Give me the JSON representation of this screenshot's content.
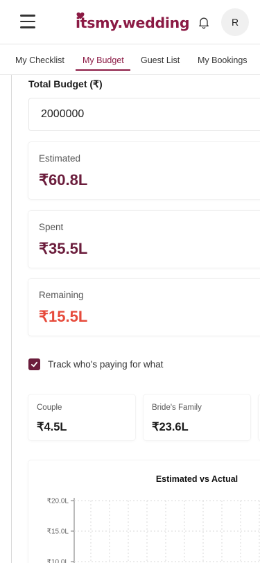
{
  "header": {
    "logo_text": "itsmy.wedding",
    "avatar_initial": "R",
    "brand_color": "#8b1a44"
  },
  "tabs": [
    {
      "label": "My Checklist",
      "active": false
    },
    {
      "label": "My Budget",
      "active": true
    },
    {
      "label": "Guest List",
      "active": false
    },
    {
      "label": "My Bookings",
      "active": false
    }
  ],
  "budget": {
    "total_label": "Total Budget (₹)",
    "total_value": "2000000"
  },
  "stats": [
    {
      "label": "Estimated",
      "value": "₹60.8L",
      "color": "#6b1d3c"
    },
    {
      "label": "Spent",
      "value": "₹35.5L",
      "color": "#6b1d3c"
    },
    {
      "label": "Remaining",
      "value": "₹15.5L",
      "color": "#e64a3b"
    }
  ],
  "tracking": {
    "label": "Track who's paying for what",
    "checked": true
  },
  "payers": [
    {
      "label": "Couple",
      "value": "₹4.5L"
    },
    {
      "label": "Bride's Family",
      "value": "₹23.6L"
    }
  ],
  "chart": {
    "title": "Estimated vs Actual",
    "y_ticks": [
      "₹20.0L",
      "₹15.0L",
      "₹10.0L"
    ]
  },
  "chart_data": {
    "type": "bar",
    "title": "Estimated vs Actual",
    "y_tick_labels": [
      "₹20.0L",
      "₹15.0L",
      "₹10.0L"
    ],
    "ylim_visible": [
      10,
      20
    ],
    "grid": true
  }
}
